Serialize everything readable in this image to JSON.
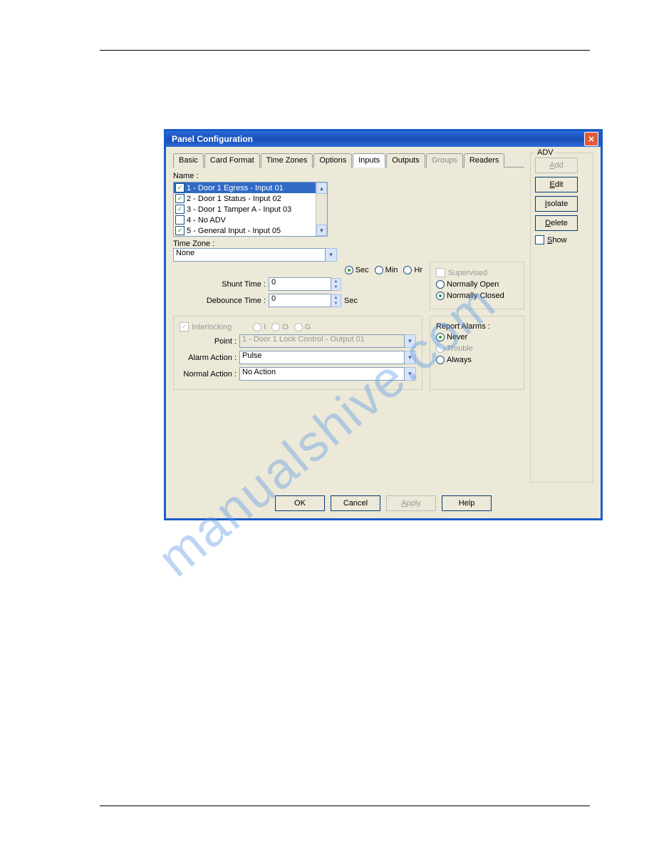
{
  "dialog": {
    "title": "Panel Configuration"
  },
  "tabs": {
    "basic": "Basic",
    "card_format": "Card Format",
    "time_zones": "Time Zones",
    "options": "Options",
    "inputs": "Inputs",
    "outputs": "Outputs",
    "groups": "Groups",
    "readers": "Readers"
  },
  "name_label": "Name :",
  "inputs_list": [
    {
      "checked": true,
      "label": "1 - Door 1 Egress - Input 01",
      "selected": true
    },
    {
      "checked": true,
      "label": "2 - Door 1 Status - Input 02",
      "selected": false
    },
    {
      "checked": true,
      "label": "3 - Door 1 Tamper A - Input 03",
      "selected": false
    },
    {
      "checked": false,
      "label": "4 - No ADV",
      "selected": false
    },
    {
      "checked": true,
      "label": "5 - General Input - Input 05",
      "selected": false
    }
  ],
  "timezone": {
    "label": "Time Zone :",
    "value": "None"
  },
  "time_unit": {
    "sec": "Sec",
    "min": "Min",
    "hr": "Hr"
  },
  "shunt": {
    "label": "Shunt Time :",
    "value": "0"
  },
  "debounce": {
    "label": "Debounce Time :",
    "value": "0",
    "unit": "Sec"
  },
  "supervised": {
    "label": "Supervised",
    "normally_open": "Normally Open",
    "normally_closed": "Normally Closed"
  },
  "interlocking": {
    "label": "Interlocking",
    "i": "I",
    "o": "O",
    "g": "G",
    "point_label": "Point :",
    "point_value": "1 - Door 1 Lock Control - Output 01",
    "alarm_label": "Alarm Action :",
    "alarm_value": "Pulse",
    "normal_label": "Normal Action :",
    "normal_value": "No Action"
  },
  "report_alarms": {
    "label": "Report Alarms :",
    "never": "Never",
    "trouble": "Trouble",
    "always": "Always"
  },
  "adv": {
    "title": "ADV",
    "add": "Add",
    "edit": "Edit",
    "isolate": "Isolate",
    "delete": "Delete",
    "show": "Show"
  },
  "buttons": {
    "ok": "OK",
    "cancel": "Cancel",
    "apply": "Apply",
    "help": "Help"
  },
  "watermark": "manualshive.com"
}
